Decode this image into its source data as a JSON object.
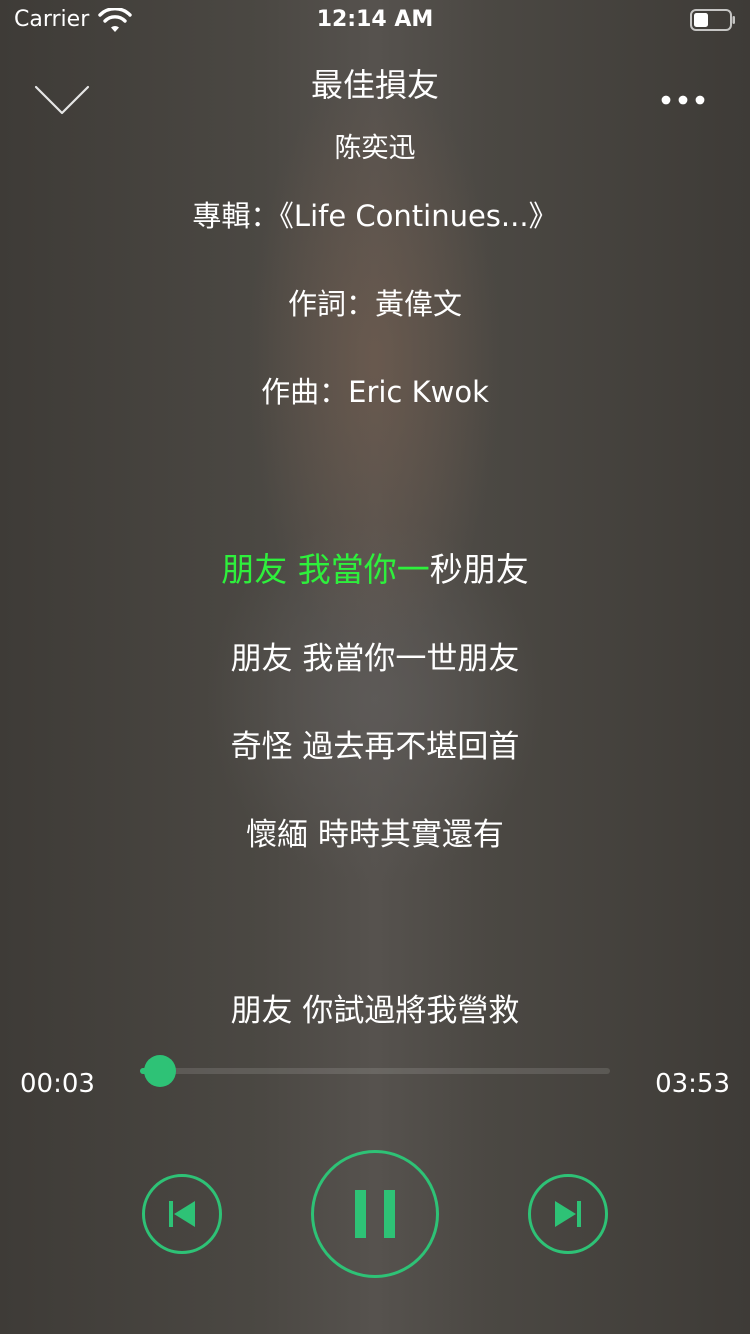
{
  "status_bar": {
    "carrier": "Carrier",
    "time": "12:14 AM"
  },
  "player": {
    "song_title": "最佳損友",
    "artist": "陈奕迅",
    "album_line": "專輯：《Life Continues...》",
    "lyricist_line": "作詞：黃偉文",
    "composer_line": "作曲：Eric Kwok"
  },
  "lyrics": {
    "current_line_sung": "朋友 我當你一",
    "current_line_rest": "秒朋友",
    "upcoming": [
      "朋友 我當你一世朋友",
      "奇怪 過去再不堪回首",
      "懷緬 時時其實還有"
    ],
    "bottom_line": "朋友 你試過將我營救"
  },
  "progress": {
    "elapsed": "00:03",
    "duration": "03:53",
    "fraction": 0.043
  },
  "colors": {
    "accent": "#2ec276",
    "lyric_highlight": "#2ef03c"
  },
  "icons": {
    "collapse": "chevron-down-icon",
    "more": "more-dots-icon",
    "previous": "previous-track-icon",
    "pause": "pause-icon",
    "next": "next-track-icon"
  }
}
